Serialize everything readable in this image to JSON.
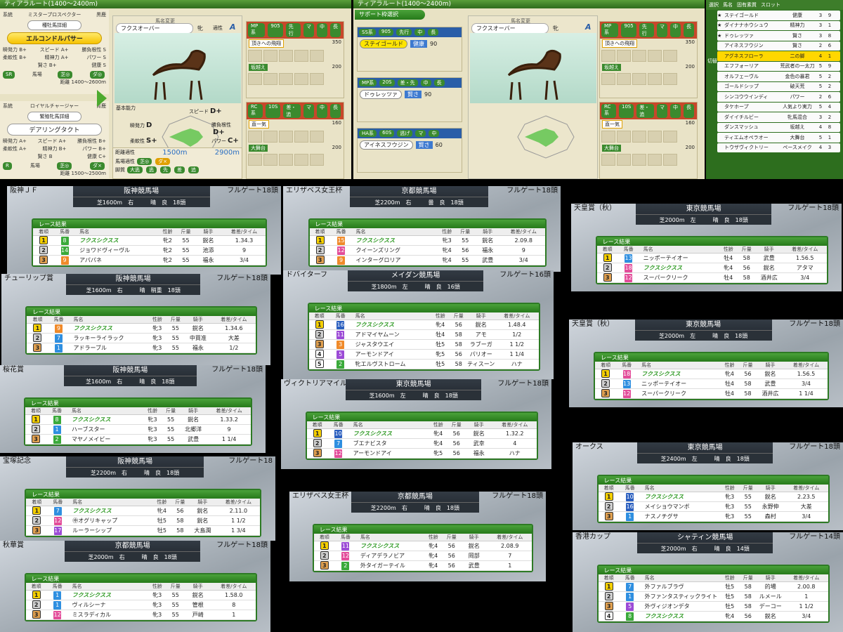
{
  "top_left": {
    "route_title": "ティアラルート(1400～2400m)",
    "sire_label": "系統",
    "sire_name": "ミスタープロスペクター",
    "sire_color": "黒鹿",
    "sire_detail_button": "種牡馬詳細",
    "stallion": "エルコンドルパサー",
    "stallion_stats": [
      [
        "瞬発力",
        "B+",
        "スピード",
        "A+",
        "勝負根性",
        "S"
      ],
      [
        "柔軟性",
        "B+",
        "精神力",
        "A+",
        "パワー",
        "S"
      ],
      [
        "",
        "",
        "賢さ",
        "B+",
        "健康",
        "S"
      ]
    ],
    "stallion_track": "馬場",
    "stallion_track_vals": [
      "芝◎",
      "ダ◎"
    ],
    "stallion_distance": "距離 1400～2600m",
    "stallion_rank": "SR",
    "dam_label": "系統",
    "dam_line": "ロイヤルチャージャー",
    "dam_color": "青鹿",
    "dam_detail_button": "繁殖牝馬詳細",
    "dam": "デアリングタクト",
    "dam_stats": [
      [
        "瞬発力",
        "A+",
        "スピード",
        "A+",
        "勝負根性",
        "B+"
      ],
      [
        "柔軟性",
        "A+",
        "精神力",
        "B+",
        "パワー",
        "B+"
      ],
      [
        "",
        "",
        "賢さ",
        "B",
        "健康",
        "C+"
      ]
    ],
    "dam_track": "馬場",
    "dam_track_vals": [
      "芝◎",
      "ダ×"
    ],
    "dam_distance": "距離 1500～2500m",
    "dam_rank": "R",
    "horse_change": "馬名変更",
    "horse_name": "フクスオーバー",
    "horse_sex": "牝",
    "aptitude_label": "適性",
    "aptitude_value": "A",
    "ability_label": "基本能力",
    "radar": [
      {
        "label": "スピード",
        "grade": "D+"
      },
      {
        "label": "勝負根性",
        "grade": "D+"
      },
      {
        "label": "パワー",
        "grade": "C+"
      },
      {
        "label": "健康",
        "grade": "E+"
      },
      {
        "label": "賢さ",
        "grade": "C+"
      },
      {
        "label": "精神力",
        "grade": "D"
      },
      {
        "label": "柔軟性",
        "grade": "S+"
      },
      {
        "label": "瞬発力",
        "grade": "D"
      }
    ],
    "distance_label": "距離適性",
    "distance_min": "1500m",
    "distance_max": "2900m",
    "surface_label": "馬場適性",
    "surface_vals": [
      "芝◎",
      "ダ×"
    ],
    "leg_label": "脚質",
    "leg_vals": [
      "大逃",
      "逃",
      "先",
      "差",
      "追"
    ],
    "support": [
      {
        "type": "MP系",
        "level": "905",
        "style": "先行",
        "tags": [
          "マ",
          "中",
          "長"
        ],
        "skill": "頂きへの飛翔",
        "value": "350",
        "skill2": "坂越え",
        "value2": "200"
      },
      {
        "type": "RC系",
        "level": "10S",
        "style": "差・追",
        "tags": [
          "マ",
          "中",
          "長"
        ],
        "skill": "直一気",
        "value": "160",
        "skill2": "大舞台",
        "value2": "200"
      }
    ]
  },
  "top_mid": {
    "route_title": "ティアラルート(1400～2400m)",
    "select_label": "サポート枠選択",
    "cards": [
      {
        "type": "SS系",
        "level": "905",
        "style": "先行",
        "tags": [
          "中",
          "長"
        ],
        "horse": "ステイゴールド",
        "skill": "健康",
        "value": "90",
        "selected": true
      },
      {
        "type": "MP系",
        "level": "20S",
        "style": "差・先",
        "tags": [
          "中",
          "長"
        ],
        "horse": "ドゥレッツァ",
        "skill": "賢さ",
        "value": "90",
        "selected": false
      },
      {
        "type": "HA系",
        "level": "60S",
        "style": "逃げ",
        "tags": [
          "マ",
          "中"
        ],
        "horse": "アイネスフウジン",
        "skill": "賢さ",
        "value": "60",
        "selected": false
      }
    ]
  },
  "top_right": {
    "headers": [
      "選択",
      "馬名",
      "固有素質",
      "スロット"
    ],
    "rows": [
      {
        "mark": "★",
        "name": "ステイゴールド",
        "trait": "健康",
        "slot": "3",
        "extra": "9"
      },
      {
        "mark": "★",
        "name": "ダイナナホウシュウ",
        "trait": "精神力",
        "slot": "3",
        "extra": "1"
      },
      {
        "mark": "★",
        "name": "ドゥレッツァ",
        "trait": "賢さ",
        "slot": "3",
        "extra": "8"
      },
      {
        "mark": "",
        "name": "アイネスフウジン",
        "trait": "賢さ",
        "slot": "2",
        "extra": "6"
      },
      {
        "mark": "",
        "name": "アグネスフローラ",
        "trait": "二の脚",
        "slot": "4",
        "extra": "1",
        "selected": true
      },
      {
        "mark": "",
        "name": "エフフォーリア",
        "trait": "荒武者の一太刀",
        "slot": "5",
        "extra": "9"
      },
      {
        "mark": "",
        "name": "オルフェーヴル",
        "trait": "金色の暴君",
        "slot": "5",
        "extra": "2"
      },
      {
        "mark": "",
        "name": "ゴールドシップ",
        "trait": "破天荒",
        "slot": "5",
        "extra": "2"
      },
      {
        "mark": "",
        "name": "シンコウウインディ",
        "trait": "パワー",
        "slot": "2",
        "extra": "6"
      },
      {
        "mark": "",
        "name": "タケホープ",
        "trait": "人気より実力",
        "slot": "5",
        "extra": "4"
      },
      {
        "mark": "",
        "name": "ダイイチルビー",
        "trait": "牝馬混合",
        "slot": "3",
        "extra": "2"
      },
      {
        "mark": "",
        "name": "ダンスマッシュ",
        "trait": "坂越え",
        "slot": "4",
        "extra": "8"
      },
      {
        "mark": "",
        "name": "ティエムオペラオー",
        "trait": "大舞台",
        "slot": "5",
        "extra": "1"
      },
      {
        "mark": "",
        "name": "トウザヴィクトリー",
        "trait": "ペースメイク",
        "slot": "4",
        "extra": "3"
      }
    ],
    "toggle": "切替"
  },
  "col_headers": [
    "着順",
    "馬番",
    "馬名",
    "性齢",
    "斤量",
    "騎手",
    "着差/タイム"
  ],
  "result_label": "レース結果",
  "races": [
    {
      "title": "阪神ＪＦ",
      "track": "阪神競馬場",
      "cond": "芝1600m　右　　　晴　良　18頭",
      "gate": "フルゲート18頭",
      "rows": [
        [
          "1",
          "8",
          "フクスシクスス",
          "牝2",
          "55",
          "鋭名",
          "1.34.3"
        ],
        [
          "2",
          "14",
          "ジョワドヴィーヴル",
          "牝2",
          "55",
          "池添",
          "9"
        ],
        [
          "3",
          "9",
          "アパパネ",
          "牝2",
          "55",
          "福永",
          "3/4"
        ]
      ]
    },
    {
      "title": "エリザベス女王杯",
      "track": "京都競馬場",
      "cond": "芝2200m　右　　　曇　良　18頭",
      "gate": "フルゲート18頭",
      "rows": [
        [
          "1",
          "15",
          "フクスシクスス",
          "牝3",
          "55",
          "鋭名",
          "2.09.8"
        ],
        [
          "2",
          "12",
          "クイーンズリング",
          "牝4",
          "56",
          "福永",
          "9"
        ],
        [
          "3",
          "9",
          "インターグロリア",
          "牝4",
          "55",
          "武豊",
          "3/4"
        ]
      ]
    },
    {
      "title": "天皇賞（秋）",
      "track": "東京競馬場",
      "cond": "芝2000m　左　　　晴　良　18頭",
      "gate": "フルゲート18頭",
      "rows": [
        [
          "1",
          "13",
          "ニッポーテイオー",
          "牡4",
          "58",
          "武豊",
          "1.56.5"
        ],
        [
          "2",
          "18",
          "フクスシクスス",
          "牝4",
          "56",
          "鋭名",
          "アタマ"
        ],
        [
          "3",
          "12",
          "スーパークリーク",
          "牡4",
          "58",
          "酒井広",
          "3/4"
        ]
      ]
    },
    {
      "title": "チューリップ賞",
      "track": "阪神競馬場",
      "cond": "芝1600m　右　　　晴　稍重　18頭",
      "gate": "フルゲート18頭",
      "rows": [
        [
          "1",
          "9",
          "フクスシクスス",
          "牝3",
          "55",
          "鋭名",
          "1.34.6"
        ],
        [
          "2",
          "7",
          "ラッキーライラック",
          "牝3",
          "55",
          "中買准",
          "大差"
        ],
        [
          "3",
          "1",
          "アドラーブル",
          "牝3",
          "55",
          "福永",
          "1/2"
        ]
      ]
    },
    {
      "title": "ドバイターフ",
      "track": "メイダン競馬場",
      "cond": "芝1800m　左　　　晴　良　16頭",
      "gate": "フルゲート16頭",
      "rows": [
        [
          "1",
          "16",
          "フクスシクスス",
          "牝4",
          "56",
          "鋭名",
          "1.48.4"
        ],
        [
          "2",
          "11",
          "アドマイヤムーン",
          "牡4",
          "58",
          "アモ",
          "1/2"
        ],
        [
          "3",
          "3",
          "ジャスタウエイ",
          "牡5",
          "58",
          "ラブーガ",
          "1 1/2"
        ],
        [
          "4",
          "5",
          "アーモンドアイ",
          "牝5",
          "56",
          "パリオー",
          "1 1/4"
        ],
        [
          "5",
          "2",
          "牝エルヴストローム",
          "牡5",
          "58",
          "ティスーン",
          "ハナ"
        ]
      ]
    },
    {
      "title": "天皇賞（秋）",
      "track": "東京競馬場",
      "cond": "芝2000m　左　　　晴　良　18頭",
      "gate": "フルゲート18頭",
      "rows": [
        [
          "1",
          "18",
          "フクスシクスス",
          "牝4",
          "56",
          "鋭名",
          "1.56.5"
        ],
        [
          "2",
          "13",
          "ニッポーテイオー",
          "牡4",
          "58",
          "武豊",
          "3/4"
        ],
        [
          "3",
          "12",
          "スーパークリーク",
          "牡4",
          "58",
          "酒井広",
          "1 1/4"
        ]
      ]
    },
    {
      "title": "桜花賞",
      "track": "阪神競馬場",
      "cond": "芝1600m　右　　　晴　良　18頭",
      "gate": "フルゲート18頭",
      "rows": [
        [
          "1",
          "8",
          "フクスシクスス",
          "牝3",
          "55",
          "鋭名",
          "1.33.2"
        ],
        [
          "2",
          "1",
          "ハーブスター",
          "牝3",
          "55",
          "北郷洋",
          "9"
        ],
        [
          "3",
          "2",
          "マヤノメイビー",
          "牝3",
          "55",
          "武豊",
          "1 1/4"
        ]
      ]
    },
    {
      "title": "ヴィクトリアマイル",
      "track": "東京競馬場",
      "cond": "芝1600m　左　　　晴　良　18頭",
      "gate": "フルゲート18頭",
      "rows": [
        [
          "1",
          "10",
          "フクスシクスス",
          "牝4",
          "56",
          "鋭名",
          "1.32.2"
        ],
        [
          "2",
          "7",
          "ブエナビスタ",
          "牝4",
          "56",
          "武幸",
          "4"
        ],
        [
          "3",
          "12",
          "アーモンドアイ",
          "牝5",
          "56",
          "福永",
          "ハナ"
        ]
      ]
    },
    {
      "title": "オークス",
      "track": "東京競馬場",
      "cond": "芝2400m　左　　　晴　良　18頭",
      "gate": "フルゲート18頭",
      "rows": [
        [
          "1",
          "10",
          "フクスシクスス",
          "牝3",
          "55",
          "鋭名",
          "2.23.5"
        ],
        [
          "2",
          "16",
          "メイショウマンボ",
          "牝3",
          "55",
          "永野伸",
          "大差"
        ],
        [
          "3",
          "1",
          "ナスノチグサ",
          "牝3",
          "55",
          "森村",
          "3/4"
        ]
      ]
    },
    {
      "title": "宝塚記念",
      "track": "阪神競馬場",
      "cond": "芝2200m　右　　　晴　良　18頭",
      "gate": "フルゲート18",
      "rows": [
        [
          "1",
          "7",
          "フクスシクスス",
          "牝4",
          "56",
          "鋭名",
          "2.11.0"
        ],
        [
          "2",
          "12",
          "㊥オグリキャップ",
          "牡5",
          "58",
          "鋭名",
          "1 1/2"
        ],
        [
          "3",
          "17",
          "ルーラーシップ",
          "牡5",
          "58",
          "大島潤",
          "1 3/4"
        ]
      ]
    },
    {
      "title": "エリザベス女王杯",
      "track": "京都競馬場",
      "cond": "芝2200m　右　　　晴　良　18頭",
      "gate": "フルゲート18頭",
      "rows": [
        [
          "1",
          "11",
          "フクスシクスス",
          "牝4",
          "56",
          "鋭名",
          "2.08.9"
        ],
        [
          "2",
          "12",
          "ディアデラノビア",
          "牝4",
          "56",
          "岡部",
          "7"
        ],
        [
          "3",
          "2",
          "外タイガーテイル",
          "牝4",
          "56",
          "武豊",
          "1"
        ]
      ]
    },
    {
      "title": "秋華賞",
      "track": "京都競馬場",
      "cond": "芝2000m　右　　　晴　良　18頭",
      "gate": "フルゲート18頭",
      "rows": [
        [
          "1",
          "1",
          "フクスシクスス",
          "牝3",
          "55",
          "鋭名",
          "1.58.0"
        ],
        [
          "2",
          "1",
          "ヴィルシーナ",
          "牝3",
          "55",
          "管根",
          "8"
        ],
        [
          "3",
          "12",
          "ミスラディカル",
          "牝3",
          "55",
          "戸崎",
          "1"
        ]
      ]
    },
    {
      "title": "香港カップ",
      "track": "シャティン競馬場",
      "cond": "芝2000m　右　　　晴　良　14頭",
      "gate": "フルゲート14頭",
      "rows": [
        [
          "1",
          "7",
          "外ファルブラヴ",
          "牡5",
          "58",
          "的場",
          "2.00.8"
        ],
        [
          "2",
          "1",
          "外ファンタスティックライト",
          "牡5",
          "58",
          "ルメール",
          "1"
        ],
        [
          "3",
          "5",
          "外ヴィジオンデタ",
          "牡5",
          "58",
          "デーコー",
          "1 1/2"
        ],
        [
          "4",
          "8",
          "フクスシクスス",
          "牝4",
          "56",
          "鋭名",
          "3/4"
        ]
      ]
    }
  ]
}
